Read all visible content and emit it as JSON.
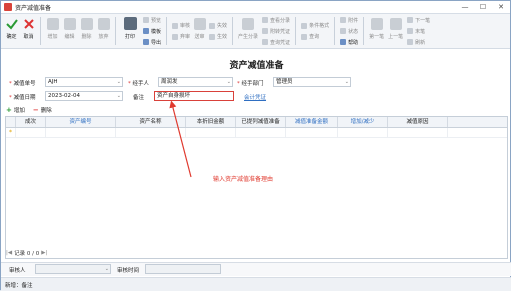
{
  "window": {
    "title": "资产减值准备",
    "controls": [
      "—",
      "☐",
      "✕"
    ]
  },
  "toolbar": {
    "confirm": "确定",
    "cancel": "取消",
    "add": "增加",
    "edit": "编辑",
    "delete": "删除",
    "abandon": "放弃",
    "print": "打印",
    "preview": "预览",
    "template": "模板",
    "export": "导出",
    "audit": "审核",
    "unaudit": "弃审",
    "submit": "送审",
    "unsubmit": "失效",
    "generate": "生效",
    "generate_voucher": "产生分录",
    "query_voucher": "查看分录",
    "attach_voucher": "附转凭证",
    "query_related": "查询凭证",
    "condition_format": "条件格式",
    "query": "查询",
    "attachment": "附件",
    "status": "状态",
    "help": "帮助",
    "first": "第一笔",
    "prev": "上一笔",
    "next": "下一笔",
    "last": "末笔",
    "refresh": "刷新"
  },
  "form": {
    "title": "资产减值准备",
    "reduction_no_label": "减值单号",
    "reduction_no_value": "AJH",
    "handler_label": "经手人",
    "handler_value": "周润发",
    "dept_label": "经手部门",
    "dept_value": "管理员",
    "date_label": "减值日期",
    "date_value": "2023-02-04",
    "remark_label": "备注",
    "remark_value": "资产自身损坏",
    "voucher_link": "会计凭证"
  },
  "subtoolbar": {
    "add": "增加",
    "delete": "删除"
  },
  "grid": {
    "columns": [
      "成次",
      "资产编号",
      "资产名称",
      "本折旧金额",
      "已提列减值准备",
      "减值准备金额",
      "增加/减少",
      "减值原因"
    ],
    "blue_columns": [
      1,
      5,
      6
    ]
  },
  "record_bar": {
    "text": "记录 0 / 0"
  },
  "audit_bar": {
    "auditor_label": "审核人",
    "audit_time_label": "审核时间"
  },
  "status_bar": {
    "text": "新增：备注"
  },
  "annotation": {
    "text": "输入资产减值准备理由"
  }
}
